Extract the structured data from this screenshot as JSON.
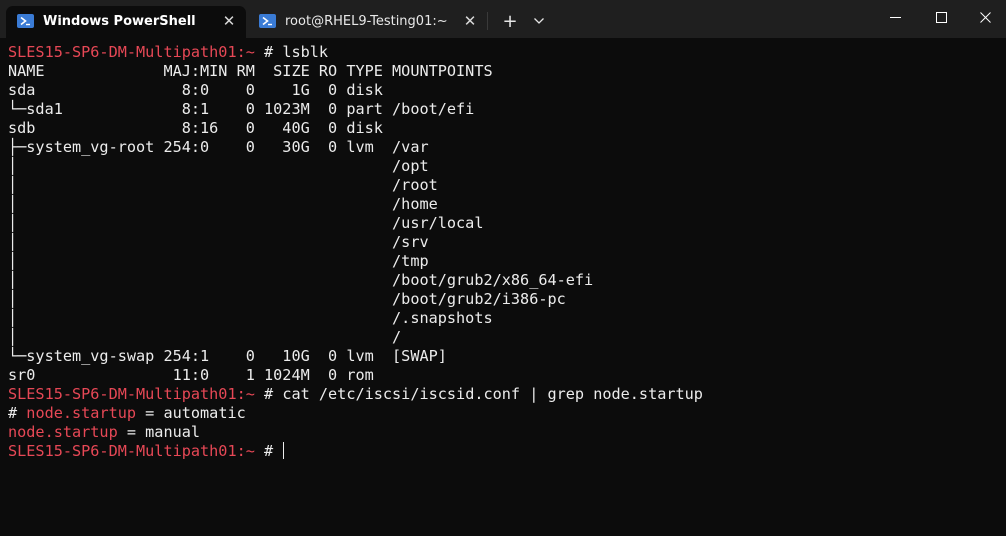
{
  "tabs": [
    {
      "label": "Windows PowerShell",
      "icon": "powershell-icon",
      "active": true
    },
    {
      "label": "root@RHEL9-Testing01:~",
      "icon": "powershell-icon",
      "active": false
    }
  ],
  "titlebar": {
    "new_tab_glyph": "+",
    "close_tab_glyph": "✕"
  },
  "colors": {
    "prompt": "#e74856",
    "text": "#ececec",
    "background": "#0c0c0c",
    "titlebar": "#1f1f1f",
    "tab_icon": "#3a7bd5"
  },
  "terminal": {
    "lines": [
      {
        "prompt": "SLES15-SP6-DM-Multipath01:~ ",
        "text": "# lsblk"
      },
      {
        "prompt": "",
        "text": "NAME             MAJ:MIN RM  SIZE RO TYPE MOUNTPOINTS"
      },
      {
        "prompt": "",
        "text": "sda                8:0    0    1G  0 disk"
      },
      {
        "prompt": "",
        "text": "└─sda1             8:1    0 1023M  0 part /boot/efi"
      },
      {
        "prompt": "",
        "text": "sdb                8:16   0   40G  0 disk"
      },
      {
        "prompt": "",
        "text": "├─system_vg-root 254:0    0   30G  0 lvm  /var"
      },
      {
        "prompt": "",
        "text": "│                                         /opt"
      },
      {
        "prompt": "",
        "text": "│                                         /root"
      },
      {
        "prompt": "",
        "text": "│                                         /home"
      },
      {
        "prompt": "",
        "text": "│                                         /usr/local"
      },
      {
        "prompt": "",
        "text": "│                                         /srv"
      },
      {
        "prompt": "",
        "text": "│                                         /tmp"
      },
      {
        "prompt": "",
        "text": "│                                         /boot/grub2/x86_64-efi"
      },
      {
        "prompt": "",
        "text": "│                                         /boot/grub2/i386-pc"
      },
      {
        "prompt": "",
        "text": "│                                         /.snapshots"
      },
      {
        "prompt": "",
        "text": "│                                         /"
      },
      {
        "prompt": "",
        "text": "└─system_vg-swap 254:1    0   10G  0 lvm  [SWAP]"
      },
      {
        "prompt": "",
        "text": "sr0               11:0    1 1024M  0 rom"
      },
      {
        "prompt": "SLES15-SP6-DM-Multipath01:~ ",
        "text": "# cat /etc/iscsi/iscsid.conf | grep node.startup"
      },
      {
        "prompt": "",
        "text": "# ",
        "highlight": "node.startup",
        "rest": " = automatic"
      },
      {
        "prompt": "",
        "text": "",
        "highlight": "node.startup",
        "rest": " = manual"
      },
      {
        "prompt": "SLES15-SP6-DM-Multipath01:~ ",
        "text": "# ",
        "cursor": true
      }
    ]
  }
}
